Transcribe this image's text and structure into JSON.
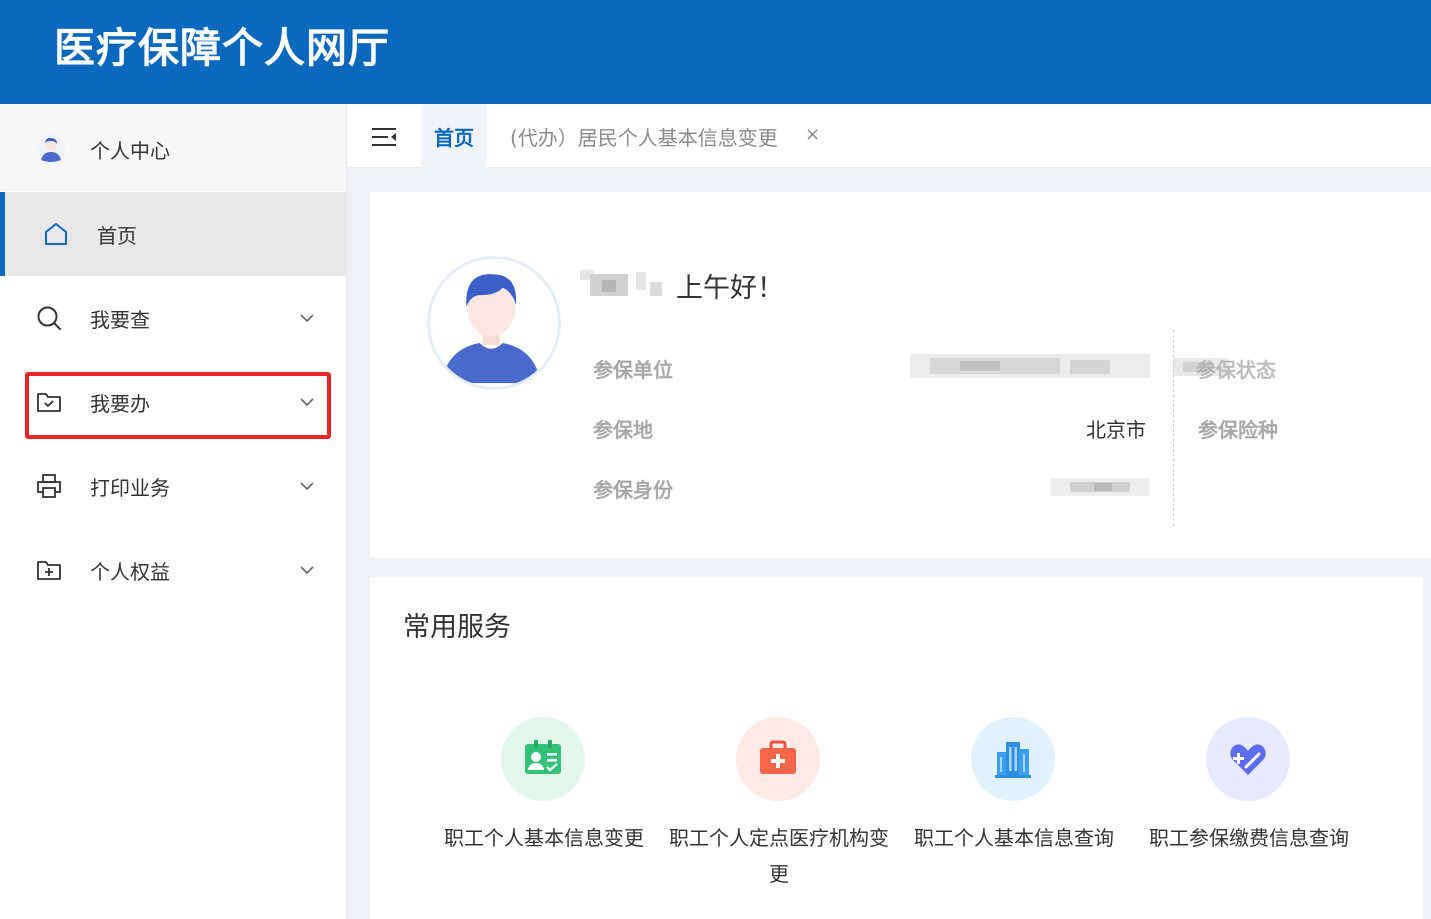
{
  "header": {
    "title": "医疗保障个人网厅"
  },
  "sidebar": {
    "profile_label": "个人中心",
    "items": [
      {
        "label": "首页"
      },
      {
        "label": "我要查"
      },
      {
        "label": "我要办"
      },
      {
        "label": "打印业务"
      },
      {
        "label": "个人权益"
      }
    ]
  },
  "tabs": {
    "home": "首页",
    "second": "(代办）居民个人基本信息变更",
    "close": "×"
  },
  "user_card": {
    "greeting": "上午好！",
    "fields": {
      "unit_label": "参保单位",
      "status_label": "参保状态",
      "location_label": "参保地",
      "location_value": "北京市",
      "insurance_type_label": "参保险种",
      "identity_label": "参保身份"
    }
  },
  "services": {
    "title": "常用服务",
    "items": [
      {
        "name": "职工个人基本信息变更",
        "icon": "id-card-icon",
        "color": "#34c27a",
        "bg": "#e3f6ec"
      },
      {
        "name": "职工个人定点医疗机构变更",
        "icon": "medical-kit-icon",
        "color": "#f7664a",
        "bg": "#fde9e5"
      },
      {
        "name": "职工个人基本信息查询",
        "icon": "building-icon",
        "color": "#3a9ff0",
        "bg": "#e1f1fd"
      },
      {
        "name": "职工参保缴费信息查询",
        "icon": "heart-plus-icon",
        "color": "#5c6cf2",
        "bg": "#e7e9fd"
      }
    ]
  },
  "colors": {
    "primary": "#0b69bd",
    "highlight": "#e8262a"
  }
}
